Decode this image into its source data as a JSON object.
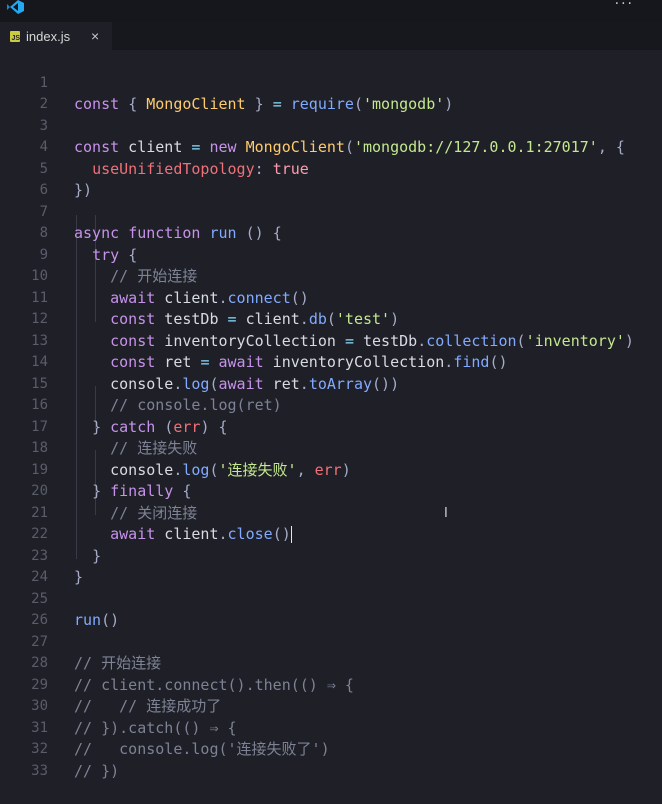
{
  "titlebar": {
    "logo_icon": "vscode-logo-icon",
    "more_label": "···"
  },
  "tab": {
    "filename": "index.js",
    "file_icon": "js-file-icon",
    "close_label": "×"
  },
  "colors": {
    "background": "#1e1f27",
    "keyword": "#c792ea",
    "class": "#ffcb6b",
    "function": "#82aaff",
    "string": "#c3e88d",
    "property": "#f07178",
    "comment": "#7d8394",
    "line_number": "#5a5d69"
  },
  "editor": {
    "line_numbers": [
      "1",
      "2",
      "3",
      "4",
      "5",
      "6",
      "7",
      "8",
      "9",
      "10",
      "11",
      "12",
      "13",
      "14",
      "15",
      "16",
      "17",
      "18",
      "19",
      "20",
      "21",
      "22",
      "23",
      "24",
      "25",
      "26",
      "27",
      "28",
      "29",
      "30",
      "31",
      "32",
      "33"
    ],
    "lines": [
      "const { MongoClient } = require('mongodb')",
      "",
      "const client = new MongoClient('mongodb://127.0.0.1:27017', {",
      "  useUnifiedTopology: true",
      "})",
      "",
      "async function run () {",
      "  try {",
      "    // 开始连接",
      "    await client.connect()",
      "    const testDb = client.db('test')",
      "    const inventoryCollection = testDb.collection('inventory')",
      "    const ret = await inventoryCollection.find()",
      "    console.log(await ret.toArray())",
      "    // console.log(ret)",
      "  } catch (err) {",
      "    // 连接失败",
      "    console.log('连接失败', err)",
      "  } finally {",
      "    // 关闭连接",
      "    await client.close()",
      "  }",
      "}",
      "",
      "run()",
      "",
      "// 开始连接",
      "// client.connect().then(() ⇒ {",
      "//   // 连接成功了",
      "// }).catch(() ⇒ {",
      "//   console.log('连接失败了')",
      "// })",
      ""
    ]
  }
}
